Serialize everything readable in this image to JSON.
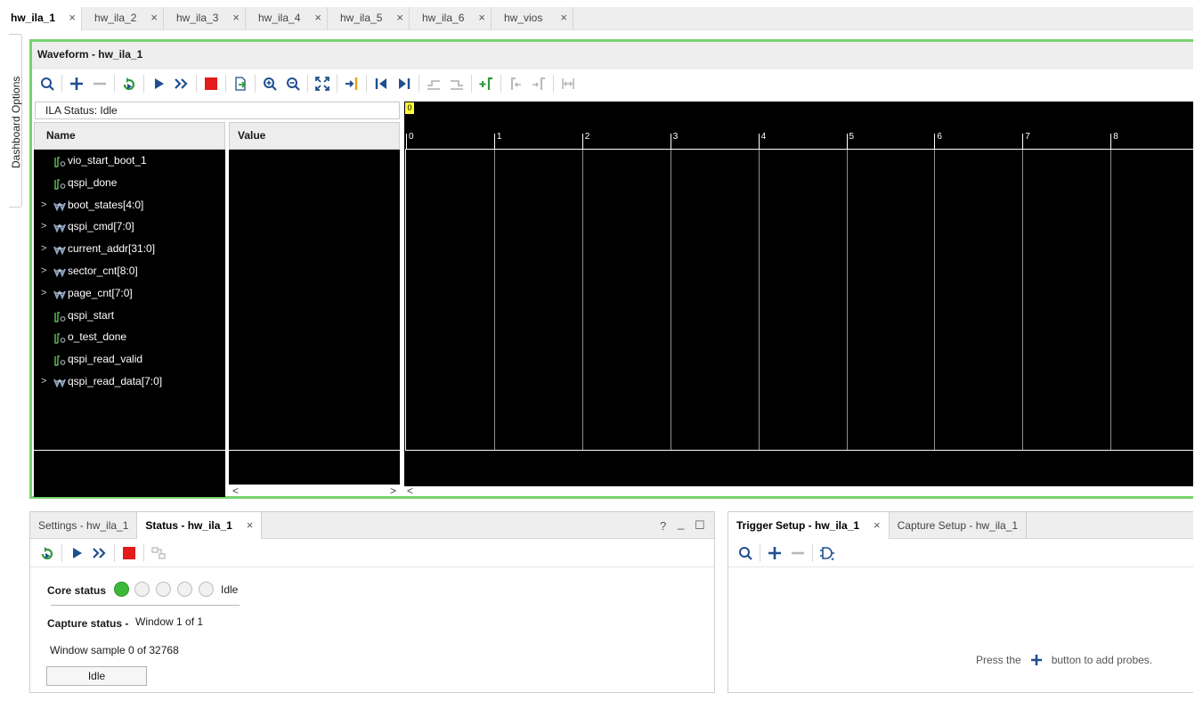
{
  "doc_tabs": [
    {
      "label": "hw_ila_1",
      "active": true
    },
    {
      "label": "hw_ila_2",
      "active": false
    },
    {
      "label": "hw_ila_3",
      "active": false
    },
    {
      "label": "hw_ila_4",
      "active": false
    },
    {
      "label": "hw_ila_5",
      "active": false
    },
    {
      "label": "hw_ila_6",
      "active": false
    },
    {
      "label": "hw_vios",
      "active": false
    }
  ],
  "close_glyph": "×",
  "side_tab": {
    "label": "Dashboard Options"
  },
  "waveform": {
    "title": "Waveform - hw_ila_1",
    "ila_status": "ILA Status: Idle",
    "name_header": "Name",
    "value_header": "Value",
    "marker_label": "0",
    "signals": [
      {
        "name": "vio_start_boot_1",
        "kind": "bit"
      },
      {
        "name": "qspi_done",
        "kind": "bit"
      },
      {
        "name": "boot_states[4:0]",
        "kind": "bus"
      },
      {
        "name": "qspi_cmd[7:0]",
        "kind": "bus"
      },
      {
        "name": "current_addr[31:0]",
        "kind": "bus"
      },
      {
        "name": "sector_cnt[8:0]",
        "kind": "bus"
      },
      {
        "name": "page_cnt[7:0]",
        "kind": "bus"
      },
      {
        "name": "qspi_start",
        "kind": "bit"
      },
      {
        "name": "o_test_done",
        "kind": "bit"
      },
      {
        "name": "qspi_read_valid",
        "kind": "bit"
      },
      {
        "name": "qspi_read_data[7:0]",
        "kind": "bus"
      }
    ],
    "ticks": [
      "0",
      "1",
      "2",
      "3",
      "4",
      "5",
      "6",
      "7",
      "8"
    ],
    "scroll": {
      "left": "<",
      "right": ">"
    }
  },
  "status_panel": {
    "tabs": [
      {
        "label": "Settings - hw_ila_1",
        "active": false
      },
      {
        "label": "Status - hw_ila_1",
        "active": true
      }
    ],
    "controls": {
      "help": "?",
      "minimize": "_",
      "maximize": "☐"
    },
    "core_status_label": "Core status",
    "core_status_value": "Idle",
    "capture_status_label": "Capture status -",
    "capture_status_value": "Window 1 of 1",
    "window_sample": "Window sample 0 of 32768",
    "progress_label": "Idle"
  },
  "trigger_panel": {
    "tabs": [
      {
        "label": "Trigger Setup - hw_ila_1",
        "active": true
      },
      {
        "label": "Capture Setup - hw_ila_1",
        "active": false
      }
    ],
    "hint_before": "Press the",
    "hint_after": "button to add probes."
  },
  "colors": {
    "accent_border": "#77d36c",
    "led_on": "#3cb83a",
    "stop_red": "#e21b1b",
    "wave_bg": "#000000",
    "marker": "#ffff33",
    "icon_blue": "#1f4f8f",
    "icon_green": "#2e9a3c"
  },
  "icons": {
    "waveform_toolbar": [
      "search-icon",
      "add-icon",
      "remove-icon",
      "refresh-run-icon",
      "run-trigger-icon",
      "run-immediate-icon",
      "stop-icon",
      "export-icon",
      "zoom-in-icon",
      "zoom-out-icon",
      "zoom-fit-icon",
      "go-to-cursor-icon",
      "go-to-start-icon",
      "go-to-end-icon",
      "prev-transition-icon",
      "next-transition-icon",
      "add-marker-icon",
      "prev-marker-icon",
      "next-marker-icon",
      "swap-cursors-icon"
    ],
    "status_toolbar": [
      "refresh-run-icon",
      "run-trigger-icon",
      "run-immediate-icon",
      "stop-icon",
      "layout-icon"
    ],
    "trigger_toolbar": [
      "search-icon",
      "add-icon",
      "remove-icon",
      "logic-gate-icon"
    ]
  }
}
